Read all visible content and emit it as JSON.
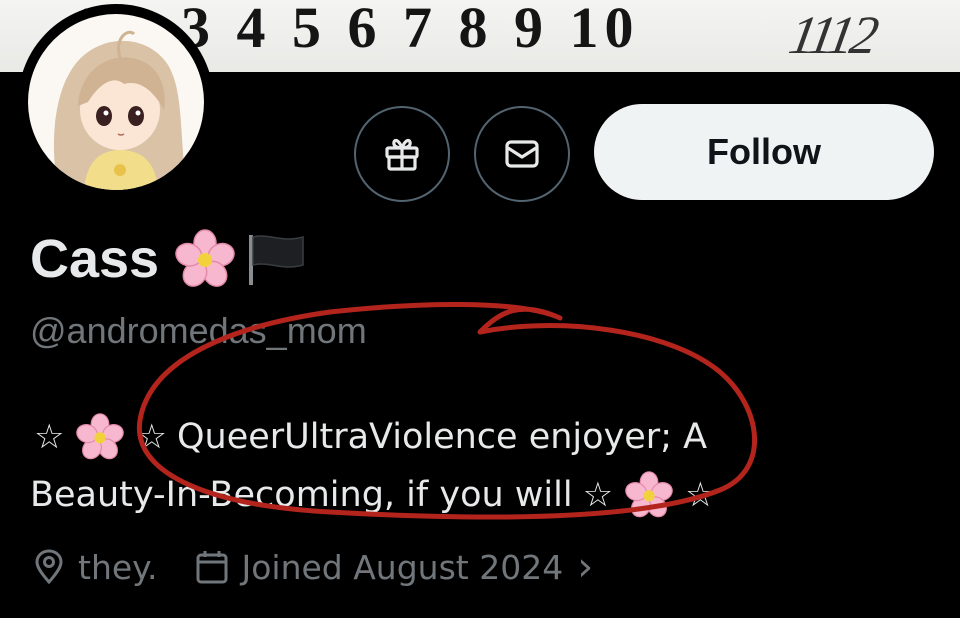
{
  "banner": {
    "numbers": "1 2 3 4 5 6 7 8 9 10",
    "scrawl": "1112"
  },
  "profile": {
    "display_name": "Cass",
    "handle": "@andromedas_mom",
    "bio_line1_text": "QueerUltraViolence enjoyer; A",
    "bio_line2_text": "Beauty-In-Becoming, if you will",
    "star": "☆",
    "pronouns": "they.",
    "joined": "Joined August 2024",
    "joined_chevron": "›"
  },
  "actions": {
    "gift_icon": "gift-icon",
    "message_icon": "envelope-icon",
    "follow_label": "Follow"
  },
  "colors": {
    "background": "#000000",
    "text": "#e7e9ea",
    "muted": "#71767b",
    "follow_bg": "#eff3f4",
    "annotation_red": "#b3241c"
  }
}
